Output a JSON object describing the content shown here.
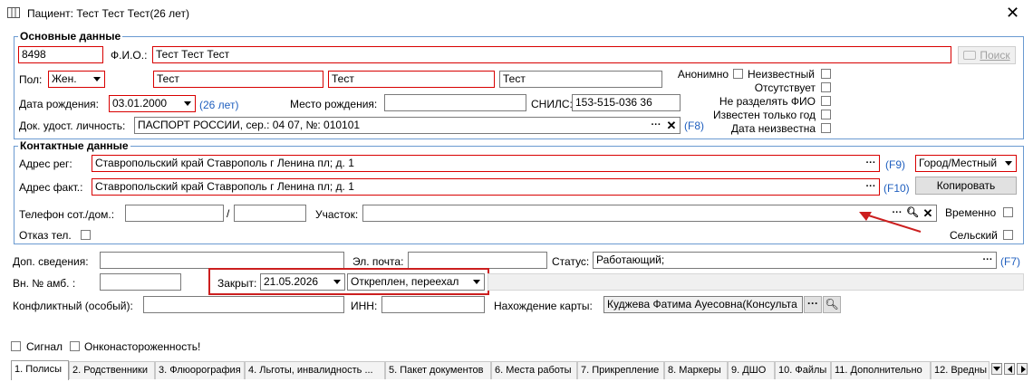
{
  "window": {
    "title": "Пациент: Тест Тест Тест(26 лет)"
  },
  "basic": {
    "title": "Основные данные",
    "id_value": "8498",
    "fio_label": "Ф.И.О.:",
    "fio_value": "Тест Тест Тест",
    "search_label": "Поиск",
    "sex_label": "Пол:",
    "sex_value": "Жен.",
    "last_name": "Тест",
    "first_name": "Тест",
    "middle_name": "Тест",
    "birth_label": "Дата рождения:",
    "birth_value": "03.01.2000",
    "age_text": "(26 лет)",
    "birthplace_label": "Место рождения:",
    "birthplace_value": "",
    "snils_label": "СНИЛС:",
    "snils_value": "153-515-036 36",
    "doc_label": "Док. удост. личность:",
    "doc_value": "ПАСПОРТ РОССИИ, сер.: 04 07, №: 010101",
    "doc_key": "(F8)",
    "flags": {
      "anonymous": "Анонимно",
      "unknown": "Неизвестный",
      "absent": "Отсутствует",
      "no_split_fio": "Не разделять ФИО",
      "year_only": "Известен только год",
      "date_unknown": "Дата неизвестна"
    }
  },
  "contact": {
    "title": "Контактные данные",
    "addr_reg_label": "Адрес рег:",
    "addr_reg_value": "Ставропольский край Ставрополь г Ленина пл; д. 1",
    "addr_reg_key": "(F9)",
    "locality_value": "Город/Местный",
    "addr_fact_label": "Адрес факт.:",
    "addr_fact_value": "Ставропольский край Ставрополь г Ленина пл; д. 1",
    "addr_fact_key": "(F10)",
    "copy_label": "Копировать",
    "phone_label": "Телефон сот./дом.:",
    "phone_mobile": "",
    "phone_sep": "/",
    "phone_home": "",
    "district_label": "Участок:",
    "district_value": "",
    "temporary_label": "Временно",
    "refuse_phone_label": "Отказ тел.",
    "rural_label": "Сельский"
  },
  "extra": {
    "info_label": "Доп. сведения:",
    "info_value": "",
    "email_label": "Эл. почта:",
    "email_value": "",
    "status_label": "Статус:",
    "status_value": "Работающий;",
    "status_key": "(F7)",
    "amb_label": "Вн. № амб. :",
    "amb_value": "",
    "closed_label": "Закрыт:",
    "closed_date": "21.05.2026",
    "closed_reason": "Откреплен, переехал",
    "conflict_label": "Конфликтный (особый):",
    "conflict_value": "",
    "inn_label": "ИНН:",
    "inn_value": "",
    "card_label": "Нахождение карты:",
    "card_value": "Куджева Фатима Ауесовна(Консульта",
    "signal_label": "Сигнал",
    "onco_label": "Онконастороженность!"
  },
  "tabs": [
    "1. Полисы",
    "2. Родственники",
    "3. Флюорография",
    "4. Льготы, инвалидность ...",
    "5. Пакет документов",
    "6. Места работы",
    "7. Прикрепление",
    "8. Маркеры",
    "9. ДШО",
    "10. Файлы",
    "11. Дополнительно",
    "12. Вредны"
  ],
  "colors": {
    "required_border": "#d80000",
    "group_border": "#6a9ad1",
    "hint_blue": "#1f5fbf",
    "arrow": "#cc1f1f"
  }
}
